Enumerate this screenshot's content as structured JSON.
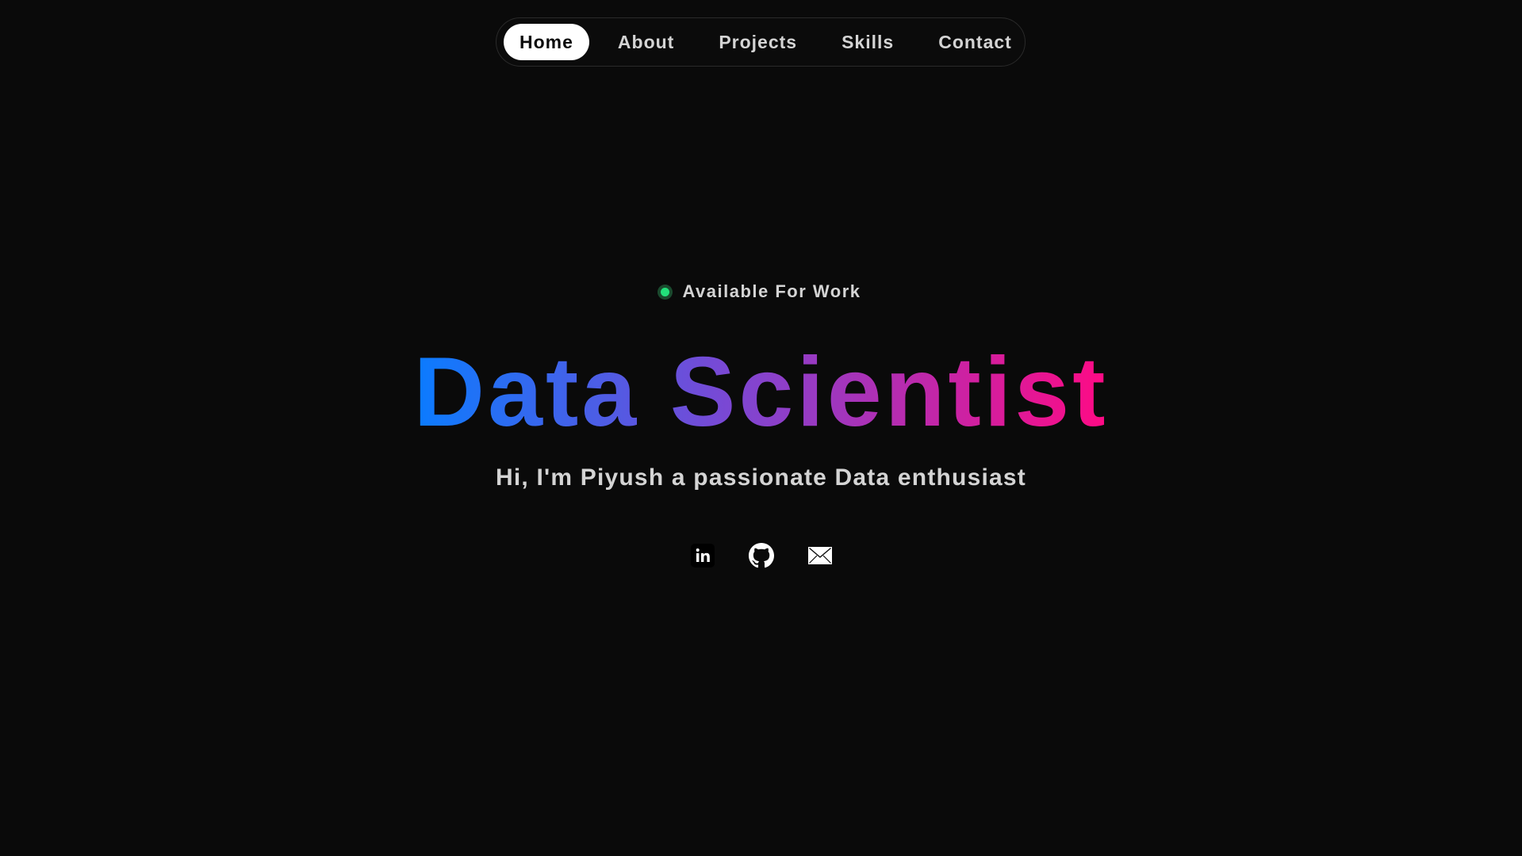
{
  "nav": {
    "items": [
      {
        "label": "Home",
        "active": true
      },
      {
        "label": "About",
        "active": false
      },
      {
        "label": "Projects",
        "active": false
      },
      {
        "label": "Skills",
        "active": false
      },
      {
        "label": "Contact",
        "active": false
      }
    ]
  },
  "hero": {
    "status": {
      "label": "Available For Work",
      "dot_color": "#22e07a"
    },
    "title": "Data Scientist",
    "title_gradient": [
      "#0a7cff",
      "#7a48d4",
      "#ff0a84"
    ],
    "subtitle": "Hi, I'm Piyush a passionate Data enthusiast"
  },
  "socials": [
    {
      "icon": "linkedin-icon"
    },
    {
      "icon": "github-icon"
    },
    {
      "icon": "mail-icon"
    }
  ],
  "colors": {
    "background": "#0a0a0a",
    "text": "#d4d4d4",
    "active_pill": "#ffffff"
  }
}
